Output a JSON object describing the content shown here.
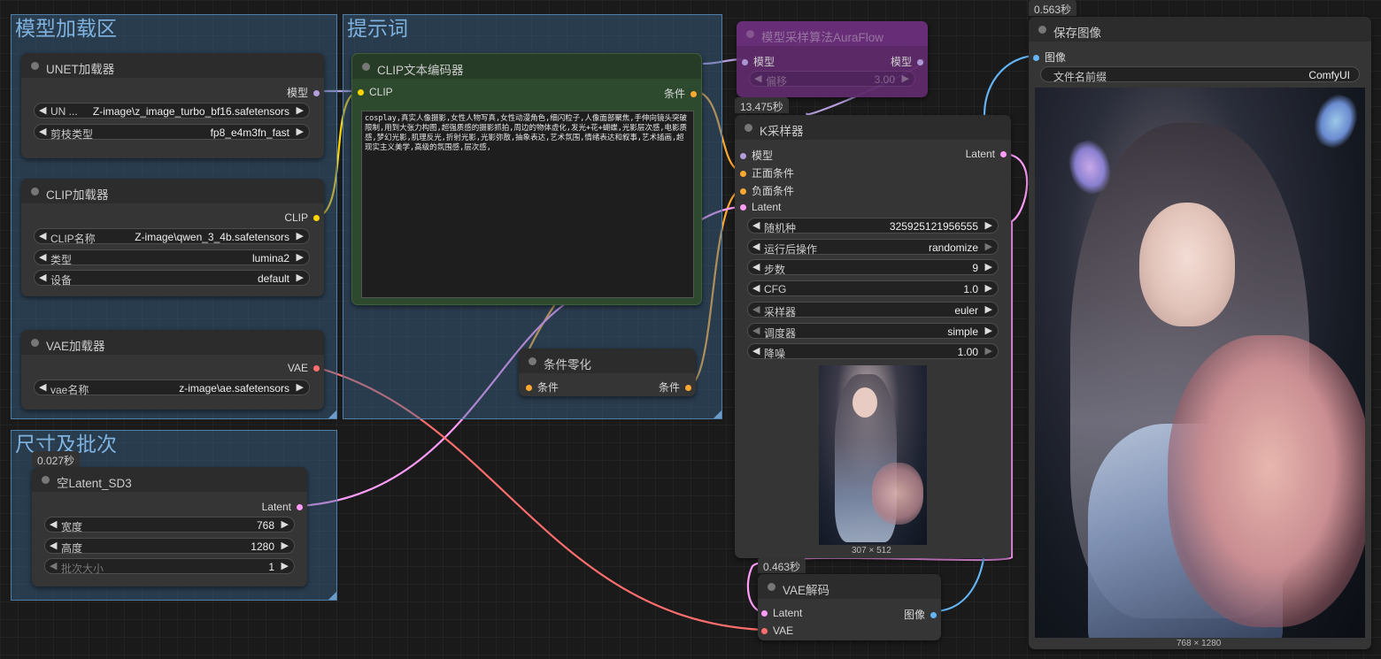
{
  "groups": {
    "model_loading": "模型加载区",
    "prompt": "提示词",
    "size_batch": "尺寸及批次"
  },
  "unet_loader": {
    "title": "UNET加载器",
    "output": "模型",
    "widgets": [
      {
        "label": "UN ...",
        "value": "Z-image\\z_image_turbo_bf16.safetensors"
      },
      {
        "label": "剪枝类型",
        "value": "fp8_e4m3fn_fast"
      }
    ]
  },
  "clip_loader": {
    "title": "CLIP加载器",
    "output": "CLIP",
    "widgets": [
      {
        "label": "CLIP名称",
        "value": "Z-image\\qwen_3_4b.safetensors"
      },
      {
        "label": "类型",
        "value": "lumina2"
      },
      {
        "label": "设备",
        "value": "default"
      }
    ]
  },
  "vae_loader": {
    "title": "VAE加载器",
    "output": "VAE",
    "widgets": [
      {
        "label": "vae名称",
        "value": "z-image\\ae.safetensors"
      }
    ]
  },
  "empty_latent": {
    "time": "0.027秒",
    "title": "空Latent_SD3",
    "output": "Latent",
    "widgets": [
      {
        "label": "宽度",
        "value": "768"
      },
      {
        "label": "高度",
        "value": "1280"
      },
      {
        "label": "批次大小",
        "value": "1"
      }
    ]
  },
  "clip_text_encoder": {
    "title": "CLIP文本编码器",
    "input": "CLIP",
    "output": "条件",
    "prompt": "cosplay,真实人像摄影,女性人物写真,女性动漫角色,细闪粒子,人像面部聚焦,手伸向镜头突破限制,用到大张力构图,超强质感的摄影抓拍,周边的物体虚化,发光+花+蝴蝶,光影层次感,电影质感,梦幻光影,肌理反光,折射光影,光影弥散,抽象表达,艺术氛围,情绪表达和叙事,艺术插画,超现实主义美学,高级的氛围感,层次感,"
  },
  "cond_zero": {
    "title": "条件零化",
    "input": "条件",
    "output": "条件"
  },
  "auraflow": {
    "title": "模型采样算法AuraFlow",
    "input": "模型",
    "output": "模型",
    "widget_label": "偏移",
    "widget_value": "3.00"
  },
  "ksampler": {
    "time": "13.475秒",
    "title": "K采样器",
    "inputs": [
      "模型",
      "正面条件",
      "负面条件",
      "Latent"
    ],
    "output": "Latent",
    "widgets": [
      {
        "label": "随机种",
        "value": "325925121956555"
      },
      {
        "label": "运行后操作",
        "value": "randomize"
      },
      {
        "label": "步数",
        "value": "9"
      },
      {
        "label": "CFG",
        "value": "1.0"
      },
      {
        "label": "采样器",
        "value": "euler"
      },
      {
        "label": "调度器",
        "value": "simple"
      },
      {
        "label": "降噪",
        "value": "1.00"
      }
    ],
    "preview_size": "307 × 512"
  },
  "vae_decode": {
    "time": "0.463秒",
    "title": "VAE解码",
    "inputs": [
      "Latent",
      "VAE"
    ],
    "output": "图像"
  },
  "save_image": {
    "time": "0.563秒",
    "title": "保存图像",
    "input": "图像",
    "widget_label": "文件名前缀",
    "widget_value": "ComfyUI",
    "image_size": "768 × 1280"
  },
  "colors": {
    "background": "#1a1a1a",
    "group": "#3d6c96",
    "node": "#353535",
    "model_wire": "#b39ddb",
    "clip_wire": "#ffd500",
    "cond_wire": "#ffa931",
    "latent_wire": "#ff9cf9",
    "vae_wire": "#ff6e6e",
    "image_wire": "#64b5f6"
  }
}
